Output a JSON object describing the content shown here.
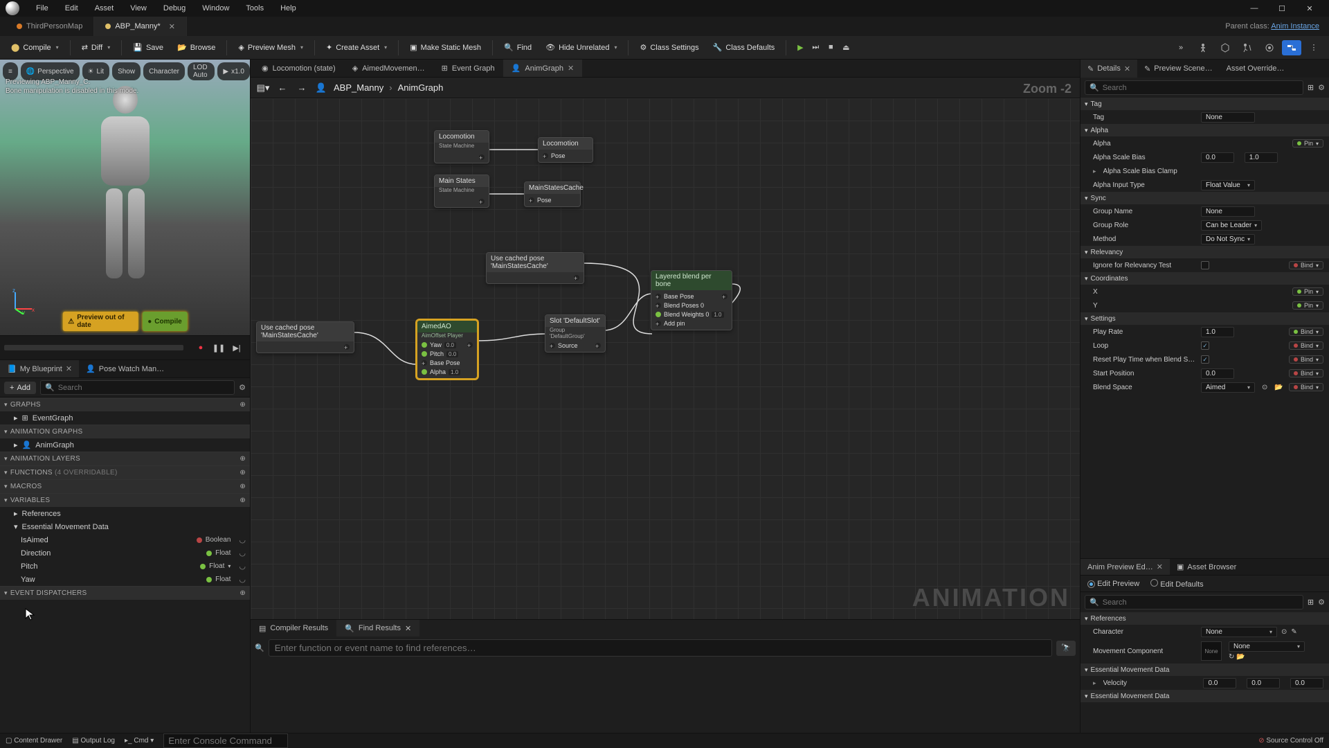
{
  "menu": [
    "File",
    "Edit",
    "Asset",
    "View",
    "Debug",
    "Window",
    "Tools",
    "Help"
  ],
  "fileTabs": [
    {
      "label": "ThirdPersonMap",
      "active": false,
      "color": "orange"
    },
    {
      "label": "ABP_Manny*",
      "active": true,
      "color": "yellow",
      "closable": true
    }
  ],
  "parentClass": {
    "prefix": "Parent class:",
    "link": "Anim Instance"
  },
  "toolbar": {
    "compile": "Compile",
    "diff": "Diff",
    "save": "Save",
    "browse": "Browse",
    "previewMesh": "Preview Mesh",
    "createAsset": "Create Asset",
    "makeStatic": "Make Static Mesh",
    "find": "Find",
    "hideUnrelated": "Hide Unrelated",
    "classSettings": "Class Settings",
    "classDefaults": "Class Defaults"
  },
  "viewport": {
    "pills": [
      "≡",
      "Perspective",
      "Lit",
      "Show",
      "Character",
      "LOD Auto",
      "x1.0"
    ],
    "overlay1": "Previewing ABP_Manny_C.",
    "overlay2": "Bone manipulation is disabled in this mode.",
    "warnPreview": "Preview out of date",
    "warnCompile": "Compile"
  },
  "leftPanelTabs": {
    "myBlueprint": "My Blueprint",
    "poseWatch": "Pose Watch Man…"
  },
  "add": "Add",
  "searchPlaceholder": "Search",
  "sections": {
    "graphs": "GRAPHS",
    "animGraphs": "ANIMATION GRAPHS",
    "animLayers": "ANIMATION LAYERS",
    "functions": "FUNCTIONS",
    "functionsSuffix": "(4 OVERRIDABLE)",
    "macros": "MACROS",
    "variables": "VARIABLES",
    "dispatchers": "EVENT DISPATCHERS"
  },
  "tree": {
    "eventGraph": "EventGraph",
    "animGraph": "AnimGraph",
    "references": "References",
    "emd": "Essential Movement Data"
  },
  "vars": [
    {
      "name": "IsAimed",
      "type": "Boolean",
      "color": "red"
    },
    {
      "name": "Direction",
      "type": "Float",
      "color": "green"
    },
    {
      "name": "Pitch",
      "type": "Float",
      "color": "green",
      "dropdown": true
    },
    {
      "name": "Yaw",
      "type": "Float",
      "color": "green"
    }
  ],
  "graphTabs": [
    {
      "label": "Locomotion (state)"
    },
    {
      "label": "AimedMovemen…"
    },
    {
      "label": "Event Graph"
    },
    {
      "label": "AnimGraph",
      "active": true,
      "closable": true
    }
  ],
  "breadcrumb": {
    "asset": "ABP_Manny",
    "graph": "AnimGraph"
  },
  "zoom": "Zoom -2",
  "watermark": "ANIMATION",
  "nodes": {
    "locomotion": {
      "t": "Locomotion",
      "s": "State Machine"
    },
    "locoOut": "Locomotion",
    "pose": "Pose",
    "mainStates": {
      "t": "Main States",
      "s": "State Machine"
    },
    "mscache": "MainStatesCache",
    "ucp1": "Use cached pose 'MainStatesCache'",
    "ucp2": "Use cached pose 'MainStatesCache'",
    "aimed": {
      "t": "AimedAO",
      "s": "AimOffset Player",
      "yaw": "Yaw",
      "pitch": "Pitch",
      "base": "Base Pose",
      "alpha": "Alpha",
      "yv": "0.0",
      "pv": "0.0",
      "av": "1.0"
    },
    "slot": {
      "t": "Slot 'DefaultSlot'",
      "s": "Group 'DefaultGroup'",
      "src": "Source"
    },
    "lbp": {
      "t": "Layered blend per bone",
      "bp": "Base Pose",
      "b0": "Blend Poses 0",
      "bw": "Blend Weights 0",
      "bwv": "1.0",
      "add": "Add pin"
    }
  },
  "resultsTabs": {
    "compiler": "Compiler Results",
    "find": "Find Results"
  },
  "findPlaceholder": "Enter function or event name to find references…",
  "rightTabs": {
    "details": "Details",
    "preview": "Preview Scene…",
    "override": "Asset Override…"
  },
  "cats": {
    "tag": "Tag",
    "alpha": "Alpha",
    "sync": "Sync",
    "relevancy": "Relevancy",
    "coordinates": "Coordinates",
    "settings": "Settings",
    "references": "References",
    "emd": "Essential Movement Data"
  },
  "props": {
    "tag": {
      "l": "Tag",
      "v": "None"
    },
    "alpha": {
      "l": "Alpha",
      "bind": "Pin"
    },
    "asb": {
      "l": "Alpha Scale Bias",
      "v1": "0.0",
      "v2": "1.0"
    },
    "asbc": {
      "l": "Alpha Scale Bias Clamp"
    },
    "ait": {
      "l": "Alpha Input Type",
      "v": "Float Value"
    },
    "gname": {
      "l": "Group Name",
      "v": "None"
    },
    "grole": {
      "l": "Group Role",
      "v": "Can be Leader"
    },
    "method": {
      "l": "Method",
      "v": "Do Not Sync"
    },
    "irt": {
      "l": "Ignore for Relevancy Test"
    },
    "x": {
      "l": "X",
      "bind": "Pin"
    },
    "y": {
      "l": "Y",
      "bind": "Pin"
    },
    "playRate": {
      "l": "Play Rate",
      "v": "1.0",
      "bind": "Bind"
    },
    "loop": {
      "l": "Loop",
      "bind": "Bind"
    },
    "reset": {
      "l": "Reset Play Time when Blend Space C…",
      "bind": "Bind"
    },
    "start": {
      "l": "Start Position",
      "v": "0.0",
      "bind": "Bind"
    },
    "bspace": {
      "l": "Blend Space",
      "v": "Aimed",
      "bind": "Bind"
    }
  },
  "apTabs": {
    "ed": "Anim Preview Ed…",
    "ab": "Asset Browser"
  },
  "apRadio": {
    "editPreview": "Edit Preview",
    "editDefaults": "Edit Defaults"
  },
  "apProps": {
    "character": {
      "l": "Character",
      "v": "None"
    },
    "mc": {
      "l": "Movement Component",
      "v": "None",
      "s": "None"
    },
    "emd": "Essential Movement Data",
    "velocity": {
      "l": "Velocity",
      "v1": "0.0",
      "v2": "0.0",
      "v3": "0.0"
    }
  },
  "status": {
    "content": "Content Drawer",
    "log": "Output Log",
    "cmd": "Cmd",
    "cmdPlaceholder": "Enter Console Command",
    "source": "Source Control Off"
  }
}
